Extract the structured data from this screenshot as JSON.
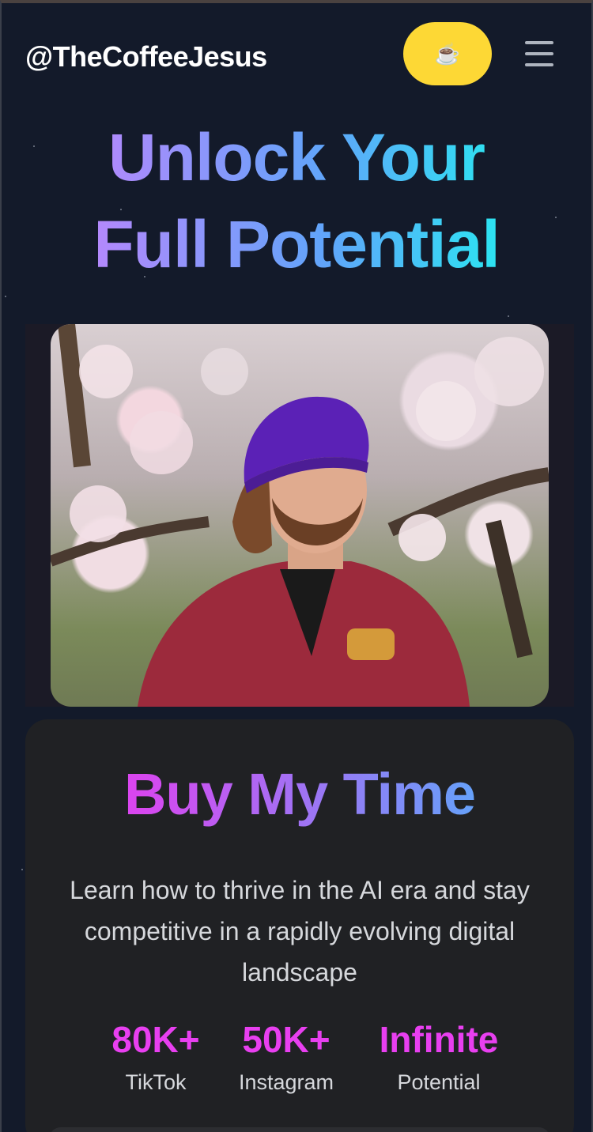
{
  "header": {
    "brand": "@TheCoffeeJesus",
    "coffee_icon": "☕",
    "menu_icon": "hamburger-menu-icon"
  },
  "hero": {
    "line1": "Unlock Your",
    "line2": "Full Potential"
  },
  "photo": {
    "subject": "smiling man in purple beanie and red jacket among cherry blossoms"
  },
  "card": {
    "title": "Buy My Time",
    "description": "Learn how to thrive in the AI era and stay competitive in a rapidly evolving digital landscape",
    "stats": [
      {
        "value": "80K+",
        "label": "TikTok"
      },
      {
        "value": "50K+",
        "label": "Instagram"
      },
      {
        "value": "Infinite",
        "label": "Potential"
      }
    ]
  },
  "colors": {
    "background": "#131a2a",
    "accent_yellow": "#fdd835",
    "accent_magenta": "#e83ff0",
    "card_bg": "#202124"
  }
}
